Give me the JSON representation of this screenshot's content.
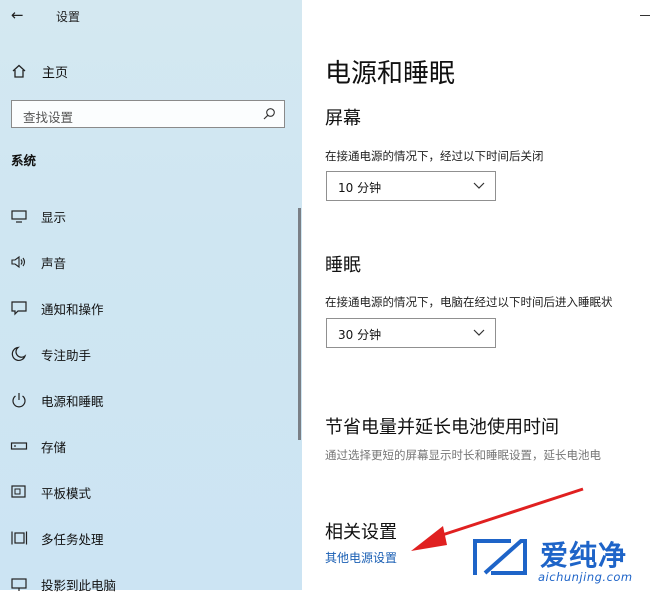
{
  "app_title": "设置",
  "sidebar": {
    "home_label": "主页",
    "search_placeholder": "查找设置",
    "section_title": "系统",
    "items": [
      {
        "label": "显示",
        "icon": "monitor-icon"
      },
      {
        "label": "声音",
        "icon": "speaker-icon"
      },
      {
        "label": "通知和操作",
        "icon": "notification-icon"
      },
      {
        "label": "专注助手",
        "icon": "moon-icon"
      },
      {
        "label": "电源和睡眠",
        "icon": "power-icon"
      },
      {
        "label": "存储",
        "icon": "storage-icon"
      },
      {
        "label": "平板模式",
        "icon": "tablet-icon"
      },
      {
        "label": "多任务处理",
        "icon": "multitask-icon"
      },
      {
        "label": "投影到此电脑",
        "icon": "project-icon"
      }
    ]
  },
  "main": {
    "page_title": "电源和睡眠",
    "screen": {
      "heading": "屏幕",
      "desc": "在接通电源的情况下，经过以下时间后关闭",
      "value": "10 分钟"
    },
    "sleep": {
      "heading": "睡眠",
      "desc": "在接通电源的情况下，电脑在经过以下时间后进入睡眠状",
      "value": "30 分钟"
    },
    "battery": {
      "heading": "节省电量并延长电池使用时间",
      "desc": "通过选择更短的屏幕显示时长和睡眠设置，延长电池电"
    },
    "related": {
      "heading": "相关设置",
      "link": "其他电源设置"
    }
  },
  "watermark": {
    "text": "爱纯净",
    "url": "aichunjing.com"
  },
  "colors": {
    "sidebar_bg": "#cfe6f2",
    "link": "#1a5fb4",
    "arrow": "#e02020",
    "watermark": "#1e64c8"
  }
}
